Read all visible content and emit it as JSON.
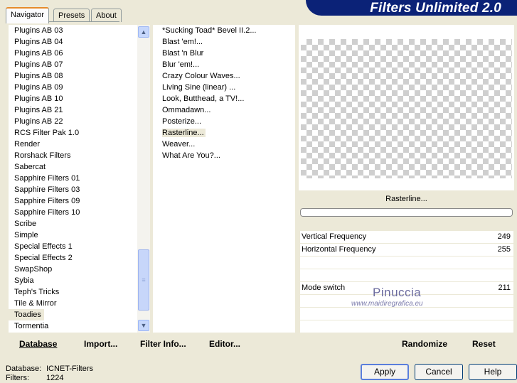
{
  "tabs": [
    {
      "label": "Navigator",
      "active": true
    },
    {
      "label": "Presets",
      "active": false
    },
    {
      "label": "About",
      "active": false
    }
  ],
  "header": {
    "title": "Filters Unlimited 2.0"
  },
  "categories": [
    "Plugins AB 03",
    "Plugins AB 04",
    "Plugins AB 06",
    "Plugins AB 07",
    "Plugins AB 08",
    "Plugins AB 09",
    "Plugins AB 10",
    "Plugins AB 21",
    "Plugins AB 22",
    "RCS Filter Pak 1.0",
    "Render",
    "Rorshack Filters",
    "Sabercat",
    "Sapphire Filters 01",
    "Sapphire Filters 03",
    "Sapphire Filters 09",
    "Sapphire Filters 10",
    "Scribe",
    "Simple",
    "Special Effects 1",
    "Special Effects 2",
    "SwapShop",
    "Sybia",
    "Teph's Tricks",
    "Tile & Mirror",
    "Toadies",
    "Tormentia"
  ],
  "selected_category": "Toadies",
  "filters": [
    "*Sucking Toad*  Bevel II.2...",
    "Blast 'em!...",
    "Blast 'n Blur",
    "Blur 'em!...",
    "Crazy Colour Waves...",
    "Living Sine (linear) ...",
    "Look, Butthead, a TV!...",
    "Ommadawn...",
    "Posterize...",
    "Rasterline...",
    "Weaver...",
    "What Are You?..."
  ],
  "selected_filter": "Rasterline...",
  "preview": {
    "filter_name": "Rasterline...",
    "progress": 0
  },
  "params": [
    {
      "label": "Vertical Frequency",
      "value": "249"
    },
    {
      "label": "Horizontal Frequency",
      "value": "255"
    },
    {
      "label": "",
      "value": ""
    },
    {
      "label": "",
      "value": ""
    },
    {
      "label": "Mode switch",
      "value": "211"
    },
    {
      "label": "",
      "value": ""
    },
    {
      "label": "",
      "value": ""
    },
    {
      "label": "",
      "value": ""
    }
  ],
  "watermark": {
    "line1": "Pinuccia",
    "line2": "www.maidiregrafica.eu"
  },
  "left_buttons": {
    "database": "Database",
    "import": "Import...",
    "filter_info": "Filter Info...",
    "editor": "Editor..."
  },
  "right_buttons": {
    "randomize": "Randomize",
    "reset": "Reset"
  },
  "footer": {
    "database_label": "Database:",
    "database_value": "ICNET-Filters",
    "filters_label": "Filters:",
    "filters_value": "1224"
  },
  "dialog_buttons": {
    "apply": "Apply",
    "cancel": "Cancel",
    "help": "Help"
  },
  "colors": {
    "header_bg": "#0b2277",
    "face": "#ece9d8",
    "tab_accent": "#e68b2c"
  }
}
